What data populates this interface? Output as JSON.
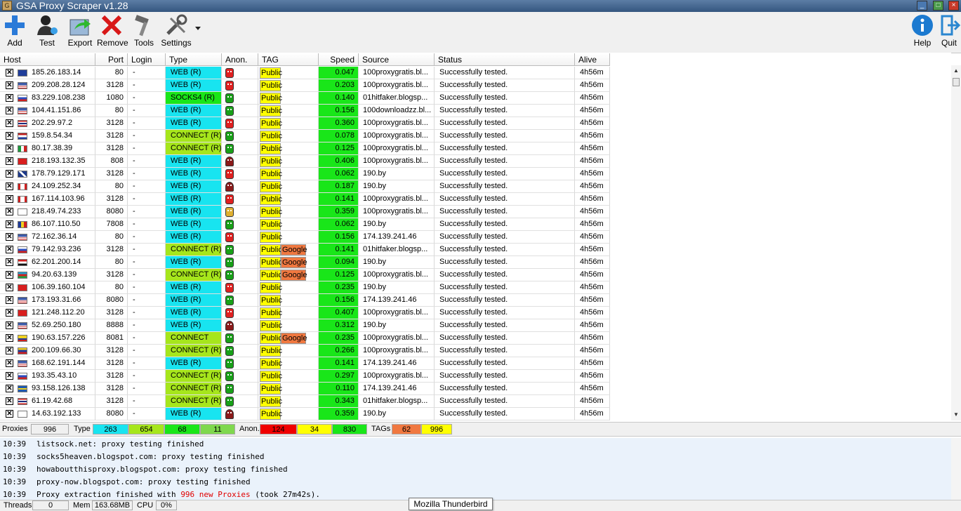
{
  "window": {
    "title": "GSA Proxy Scraper v1.28"
  },
  "toolbar": {
    "add": "Add",
    "test": "Test",
    "export": "Export",
    "remove": "Remove",
    "tools": "Tools",
    "settings": "Settings",
    "help": "Help",
    "quit": "Quit"
  },
  "columns": {
    "host": "Host",
    "port": "Port",
    "login": "Login",
    "type": "Type",
    "anon": "Anon.",
    "tag": "TAG",
    "speed": "Speed",
    "source": "Source",
    "status": "Status",
    "alive": "Alive"
  },
  "colors": {
    "web": "#18e4f0",
    "socks": "#19e619",
    "connect": "#a6e61c",
    "public": "#ffff00",
    "google": "#f07840",
    "speed": "#19e619"
  },
  "rows": [
    {
      "check": "✕",
      "flag": "eu",
      "ip": "185.26.183.14",
      "port": "80",
      "login": "-",
      "type": "WEB (R)",
      "type_kind": "web",
      "anon": "red",
      "tag1": "Public",
      "tag2": "",
      "speed": "0.047",
      "source": "100proxygratis.bl...",
      "status": "Successfully tested.",
      "alive": "4h56m"
    },
    {
      "check": "✕",
      "flag": "us",
      "ip": "209.208.28.124",
      "port": "3128",
      "login": "-",
      "type": "WEB (R)",
      "type_kind": "web",
      "anon": "red",
      "tag1": "Public",
      "tag2": "",
      "speed": "0.203",
      "source": "100proxygratis.bl...",
      "status": "Successfully tested.",
      "alive": "4h56m"
    },
    {
      "check": "✕",
      "flag": "ru",
      "ip": "83.229.108.238",
      "port": "1080",
      "login": "-",
      "type": "SOCKS4 (R)",
      "type_kind": "socks",
      "anon": "green",
      "tag1": "Public",
      "tag2": "",
      "speed": "0.140",
      "source": "01hitfaker.blogsp...",
      "status": "Successfully tested.",
      "alive": "4h56m"
    },
    {
      "check": "✕",
      "flag": "us",
      "ip": "104.41.151.86",
      "port": "80",
      "login": "-",
      "type": "WEB (R)",
      "type_kind": "web",
      "anon": "green",
      "tag1": "Public",
      "tag2": "",
      "speed": "0.156",
      "source": "100downloadzz.bl...",
      "status": "Successfully tested.",
      "alive": "4h56m"
    },
    {
      "check": "✕",
      "flag": "th",
      "ip": "202.29.97.2",
      "port": "3128",
      "login": "-",
      "type": "WEB (R)",
      "type_kind": "web",
      "anon": "red",
      "tag1": "Public",
      "tag2": "",
      "speed": "0.360",
      "source": "100proxygratis.bl...",
      "status": "Successfully tested.",
      "alive": "4h56m"
    },
    {
      "check": "✕",
      "flag": "nl",
      "ip": "159.8.54.34",
      "port": "3128",
      "login": "-",
      "type": "CONNECT (R)",
      "type_kind": "connect",
      "anon": "green",
      "tag1": "Public",
      "tag2": "",
      "speed": "0.078",
      "source": "100proxygratis.bl...",
      "status": "Successfully tested.",
      "alive": "4h56m"
    },
    {
      "check": "✕",
      "flag": "it",
      "ip": "80.17.38.39",
      "port": "3128",
      "login": "-",
      "type": "CONNECT (R)",
      "type_kind": "connect",
      "anon": "green",
      "tag1": "Public",
      "tag2": "",
      "speed": "0.125",
      "source": "100proxygratis.bl...",
      "status": "Successfully tested.",
      "alive": "4h56m"
    },
    {
      "check": "✕",
      "flag": "cn",
      "ip": "218.193.132.35",
      "port": "808",
      "login": "-",
      "type": "WEB (R)",
      "type_kind": "web",
      "anon": "spy",
      "tag1": "Public",
      "tag2": "",
      "speed": "0.406",
      "source": "100proxygratis.bl...",
      "status": "Successfully tested.",
      "alive": "4h56m"
    },
    {
      "check": "✕",
      "flag": "gb",
      "ip": "178.79.129.171",
      "port": "3128",
      "login": "-",
      "type": "WEB (R)",
      "type_kind": "web",
      "anon": "red",
      "tag1": "Public",
      "tag2": "",
      "speed": "0.062",
      "source": "190.by",
      "status": "Successfully tested.",
      "alive": "4h56m"
    },
    {
      "check": "✕",
      "flag": "ca",
      "ip": "24.109.252.34",
      "port": "80",
      "login": "-",
      "type": "WEB (R)",
      "type_kind": "web",
      "anon": "spy",
      "tag1": "Public",
      "tag2": "",
      "speed": "0.187",
      "source": "190.by",
      "status": "Successfully tested.",
      "alive": "4h56m"
    },
    {
      "check": "✕",
      "flag": "ca",
      "ip": "167.114.103.96",
      "port": "3128",
      "login": "-",
      "type": "WEB (R)",
      "type_kind": "web",
      "anon": "red",
      "tag1": "Public",
      "tag2": "",
      "speed": "0.141",
      "source": "100proxygratis.bl...",
      "status": "Successfully tested.",
      "alive": "4h56m"
    },
    {
      "check": "✕",
      "flag": "kr",
      "ip": "218.49.74.233",
      "port": "8080",
      "login": "-",
      "type": "WEB (R)",
      "type_kind": "web",
      "anon": "gold",
      "tag1": "Public",
      "tag2": "",
      "speed": "0.359",
      "source": "100proxygratis.bl...",
      "status": "Successfully tested.",
      "alive": "4h56m"
    },
    {
      "check": "✕",
      "flag": "ro",
      "ip": "86.107.110.50",
      "port": "7808",
      "login": "-",
      "type": "WEB (R)",
      "type_kind": "web",
      "anon": "green",
      "tag1": "Public",
      "tag2": "",
      "speed": "0.062",
      "source": "190.by",
      "status": "Successfully tested.",
      "alive": "4h56m"
    },
    {
      "check": "✕",
      "flag": "us",
      "ip": "72.162.36.14",
      "port": "80",
      "login": "-",
      "type": "WEB (R)",
      "type_kind": "web",
      "anon": "red",
      "tag1": "Public",
      "tag2": "",
      "speed": "0.156",
      "source": "174.139.241.46",
      "status": "Successfully tested.",
      "alive": "4h56m"
    },
    {
      "check": "✕",
      "flag": "ru",
      "ip": "79.142.93.236",
      "port": "3128",
      "login": "-",
      "type": "CONNECT (R)",
      "type_kind": "connect",
      "anon": "green",
      "tag1": "Public",
      "tag2": "Google",
      "speed": "0.141",
      "source": "01hitfaker.blogsp...",
      "status": "Successfully tested.",
      "alive": "4h56m"
    },
    {
      "check": "✕",
      "flag": "eg",
      "ip": "62.201.200.14",
      "port": "80",
      "login": "-",
      "type": "WEB (R)",
      "type_kind": "web",
      "anon": "green",
      "tag1": "Public",
      "tag2": "Google",
      "speed": "0.094",
      "source": "190.by",
      "status": "Successfully tested.",
      "alive": "4h56m"
    },
    {
      "check": "✕",
      "flag": "az",
      "ip": "94.20.63.139",
      "port": "3128",
      "login": "-",
      "type": "CONNECT (R)",
      "type_kind": "connect",
      "anon": "green",
      "tag1": "Public",
      "tag2": "Google",
      "speed": "0.125",
      "source": "100proxygratis.bl...",
      "status": "Successfully tested.",
      "alive": "4h56m"
    },
    {
      "check": "✕",
      "flag": "cn",
      "ip": "106.39.160.104",
      "port": "80",
      "login": "-",
      "type": "WEB (R)",
      "type_kind": "web",
      "anon": "red",
      "tag1": "Public",
      "tag2": "",
      "speed": "0.235",
      "source": "190.by",
      "status": "Successfully tested.",
      "alive": "4h56m"
    },
    {
      "check": "✕",
      "flag": "us",
      "ip": "173.193.31.66",
      "port": "8080",
      "login": "-",
      "type": "WEB (R)",
      "type_kind": "web",
      "anon": "green",
      "tag1": "Public",
      "tag2": "",
      "speed": "0.156",
      "source": "174.139.241.46",
      "status": "Successfully tested.",
      "alive": "4h56m"
    },
    {
      "check": "✕",
      "flag": "cn",
      "ip": "121.248.112.20",
      "port": "3128",
      "login": "-",
      "type": "WEB (R)",
      "type_kind": "web",
      "anon": "red",
      "tag1": "Public",
      "tag2": "",
      "speed": "0.407",
      "source": "100proxygratis.bl...",
      "status": "Successfully tested.",
      "alive": "4h56m"
    },
    {
      "check": "✕",
      "flag": "us",
      "ip": "52.69.250.180",
      "port": "8888",
      "login": "-",
      "type": "WEB (R)",
      "type_kind": "web",
      "anon": "spy",
      "tag1": "Public",
      "tag2": "",
      "speed": "0.312",
      "source": "190.by",
      "status": "Successfully tested.",
      "alive": "4h56m"
    },
    {
      "check": "✕",
      "flag": "co",
      "ip": "190.63.157.226",
      "port": "8081",
      "login": "-",
      "type": "CONNECT",
      "type_kind": "connect",
      "anon": "green",
      "tag1": "Public",
      "tag2": "Google",
      "speed": "0.235",
      "source": "100proxygratis.bl...",
      "status": "Successfully tested.",
      "alive": "4h56m"
    },
    {
      "check": "✕",
      "flag": "ve",
      "ip": "200.109.66.30",
      "port": "3128",
      "login": "-",
      "type": "CONNECT (R)",
      "type_kind": "connect",
      "anon": "green",
      "tag1": "Public",
      "tag2": "",
      "speed": "0.266",
      "source": "100proxygratis.bl...",
      "status": "Successfully tested.",
      "alive": "4h56m"
    },
    {
      "check": "✕",
      "flag": "us",
      "ip": "168.62.191.144",
      "port": "3128",
      "login": "-",
      "type": "WEB (R)",
      "type_kind": "web",
      "anon": "green",
      "tag1": "Public",
      "tag2": "",
      "speed": "0.141",
      "source": "174.139.241.46",
      "status": "Successfully tested.",
      "alive": "4h56m"
    },
    {
      "check": "✕",
      "flag": "ru",
      "ip": "193.35.43.10",
      "port": "3128",
      "login": "-",
      "type": "CONNECT (R)",
      "type_kind": "connect",
      "anon": "green",
      "tag1": "Public",
      "tag2": "",
      "speed": "0.297",
      "source": "100proxygratis.bl...",
      "status": "Successfully tested.",
      "alive": "4h56m"
    },
    {
      "check": "✕",
      "flag": "se",
      "ip": "93.158.126.138",
      "port": "3128",
      "login": "-",
      "type": "CONNECT (R)",
      "type_kind": "connect",
      "anon": "green",
      "tag1": "Public",
      "tag2": "",
      "speed": "0.110",
      "source": "174.139.241.46",
      "status": "Successfully tested.",
      "alive": "4h56m"
    },
    {
      "check": "✕",
      "flag": "th",
      "ip": "61.19.42.68",
      "port": "3128",
      "login": "-",
      "type": "CONNECT (R)",
      "type_kind": "connect",
      "anon": "green",
      "tag1": "Public",
      "tag2": "",
      "speed": "0.343",
      "source": "01hitfaker.blogsp...",
      "status": "Successfully tested.",
      "alive": "4h56m"
    },
    {
      "check": "✕",
      "flag": "kr",
      "ip": "14.63.192.133",
      "port": "8080",
      "login": "-",
      "type": "WEB (R)",
      "type_kind": "web",
      "anon": "spy",
      "tag1": "Public",
      "tag2": "",
      "speed": "0.359",
      "source": "190.by",
      "status": "Successfully tested.",
      "alive": "4h56m"
    }
  ],
  "statusbar": {
    "proxies_label": "Proxies",
    "proxies_count": "996",
    "type_label": "Type",
    "type_web": "263",
    "type_connect": "654",
    "type_socks": "68",
    "type_other": "11",
    "anon_label": "Anon.",
    "anon_transparent": "124",
    "anon_anonymous": "34",
    "anon_elite": "830",
    "tags_label": "TAGs",
    "tags_google": "62",
    "tags_public": "996"
  },
  "log": [
    {
      "time": "10:39",
      "msg": "listsock.net: proxy testing finished"
    },
    {
      "time": "10:39",
      "msg": "socks5heaven.blogspot.com: proxy testing finished"
    },
    {
      "time": "10:39",
      "msg": "howaboutthisproxy.blogspot.com: proxy testing finished"
    },
    {
      "time": "10:39",
      "msg": "proxy-now.blogspot.com: proxy testing finished"
    },
    {
      "time": "10:39",
      "msg_pre": "Proxy extraction finished with ",
      "msg_hl": "996 new Proxies",
      "msg_post": " (took 27m42s)."
    }
  ],
  "bottombar": {
    "threads_label": "Threads",
    "threads": "0",
    "mem_label": "Mem",
    "mem": "163.68MB",
    "cpu_label": "CPU",
    "cpu": "0%"
  },
  "tooltip": "Mozilla Thunderbird"
}
